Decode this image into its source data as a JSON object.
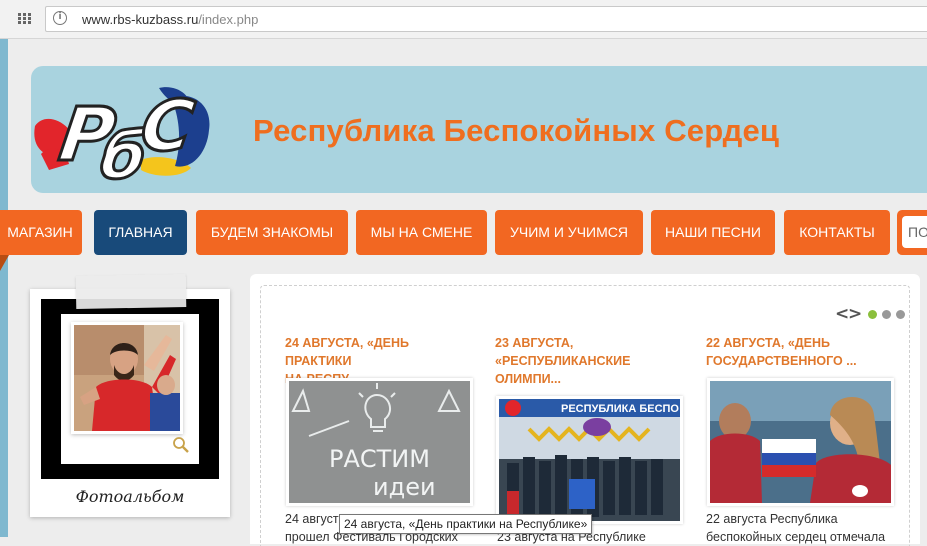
{
  "browser": {
    "url_host": "www.rbs-kuzbass.ru",
    "url_path": "/index.php",
    "apps_icon": "apps-grid-icon",
    "info_icon": "info-icon"
  },
  "site": {
    "logo_text": "РбС",
    "title": "Республика Беспокойных Сердец"
  },
  "nav": {
    "items": [
      {
        "label": "МАГАЗИН"
      },
      {
        "label": "ГЛАВНАЯ",
        "active": true
      },
      {
        "label": "БУДЕМ ЗНАКОМЫ"
      },
      {
        "label": "МЫ НА СМЕНЕ"
      },
      {
        "label": "УЧИМ И УЧИМСЯ"
      },
      {
        "label": "НАШИ ПЕСНИ"
      },
      {
        "label": "КОНТАКТЫ"
      }
    ],
    "search_placeholder": "ПО"
  },
  "album": {
    "caption": "Фотоальбом",
    "zoom_icon": "magnifier-icon"
  },
  "news": {
    "items": [
      {
        "title_line1": "24 АВГУСТА, «ДЕНЬ ПРАКТИКИ",
        "title_line2": "НА РЕСПУ...",
        "image_text_line1": "РАСТИМ",
        "image_text_line2": "идеи",
        "text_line1": "24 август",
        "text_line2": "прошел Фестиваль Городских"
      },
      {
        "title_line1": "23 АВГУСТА,",
        "title_line2": "«РЕСПУБЛИКАНСКИЕ",
        "title_line3": "ОЛИМПИ...",
        "image_banner": "РЕСПУБЛИКА БЕСПО",
        "text_line1": "23 августа на Республике"
      },
      {
        "title_line1": "22 АВГУСТА, «ДЕНЬ",
        "title_line2": "ГОСУДАРСТВЕННОГО ...",
        "text_line1": "22 августа Республика",
        "text_line2": "беспокойных сердец отмечала"
      }
    ],
    "tooltip": "24 августа, «День практики на Республике»"
  },
  "slider": {
    "prev_icon": "chevron-left-icon",
    "next_icon": "chevron-right-icon",
    "prev_glyph": "<",
    "next_glyph": ">",
    "dots": 3,
    "active_dot": 0
  },
  "colors": {
    "accent_orange": "#f26722",
    "nav_active": "#184a7a",
    "banner_bg": "#a9d3df",
    "title_orange": "#ef6e1f",
    "news_title": "#e0782c"
  }
}
